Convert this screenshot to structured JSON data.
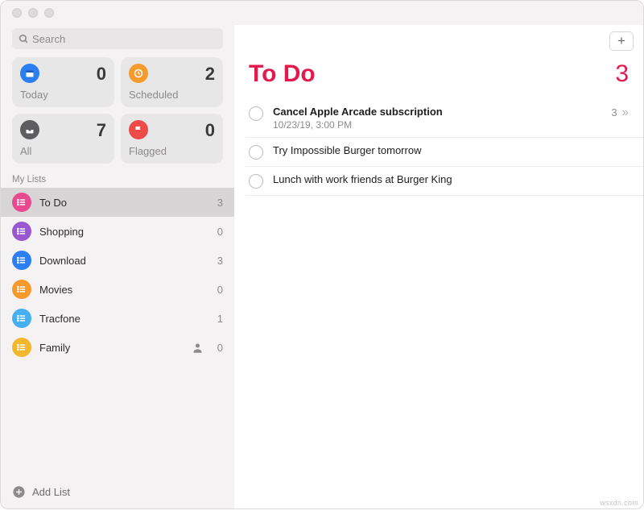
{
  "search": {
    "placeholder": "Search"
  },
  "cards": {
    "today": {
      "label": "Today",
      "count": 0
    },
    "scheduled": {
      "label": "Scheduled",
      "count": 2
    },
    "all": {
      "label": "All",
      "count": 7
    },
    "flagged": {
      "label": "Flagged",
      "count": 0
    }
  },
  "section_header": "My Lists",
  "lists": [
    {
      "name": "To Do",
      "count": 3,
      "color": "bg-pink",
      "shared": false,
      "selected": true
    },
    {
      "name": "Shopping",
      "count": 0,
      "color": "bg-purple",
      "shared": false,
      "selected": false
    },
    {
      "name": "Download",
      "count": 3,
      "color": "bg-blue",
      "shared": false,
      "selected": false
    },
    {
      "name": "Movies",
      "count": 0,
      "color": "bg-orange",
      "shared": false,
      "selected": false
    },
    {
      "name": "Tracfone",
      "count": 1,
      "color": "bg-lblue",
      "shared": false,
      "selected": false
    },
    {
      "name": "Family",
      "count": 0,
      "color": "bg-yellow",
      "shared": true,
      "selected": false
    }
  ],
  "footer": {
    "add_list": "Add List"
  },
  "main": {
    "title": "To Do",
    "count": 3,
    "reminders": [
      {
        "title": "Cancel Apple Arcade subscription",
        "subtitle": "10/23/19, 3:00 PM",
        "subtask_count": 3,
        "has_subtasks": true,
        "bold": true
      },
      {
        "title": "Try Impossible Burger tomorrow"
      },
      {
        "title": "Lunch with work friends at Burger King"
      }
    ]
  },
  "watermark": "wsxdn.com"
}
